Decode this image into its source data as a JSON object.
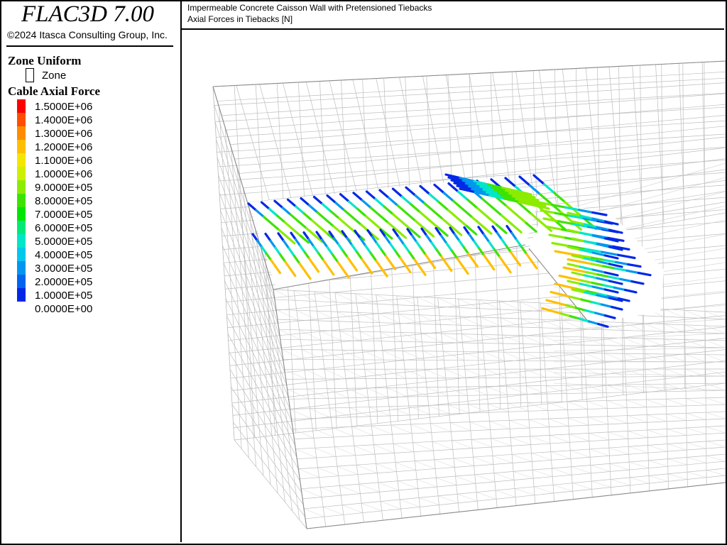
{
  "app": {
    "title": "FLAC3D 7.00",
    "copyright": "©2024 Itasca Consulting Group, Inc."
  },
  "header": {
    "line1": "Impermeable Concrete Caisson Wall with Pretensioned Tiebacks",
    "line2": "Axial Forces in Tiebacks [N]"
  },
  "legend": {
    "zone_section": "Zone Uniform",
    "zone_item": "Zone",
    "cable_section": "Cable Axial Force",
    "ticks": [
      "1.5000E+06",
      "1.4000E+06",
      "1.3000E+06",
      "1.2000E+06",
      "1.1000E+06",
      "1.0000E+06",
      "9.0000E+05",
      "8.0000E+05",
      "7.0000E+05",
      "6.0000E+05",
      "5.0000E+05",
      "4.0000E+05",
      "3.0000E+05",
      "2.0000E+05",
      "1.0000E+05",
      "0.0000E+00"
    ],
    "colors": [
      "#ff0000",
      "#ff4e00",
      "#ff8c00",
      "#ffbf00",
      "#f5e600",
      "#cdf000",
      "#8cec00",
      "#3de300",
      "#00e600",
      "#00ea78",
      "#00e6c8",
      "#00c8ee",
      "#0096f0",
      "#0064f0",
      "#0028e6"
    ]
  },
  "model": {
    "mesh_color": "#bdbdbd",
    "cable_colors": {
      "low": "#0028e6",
      "mid_low": "#0096f0",
      "mid": "#00e6c8",
      "mid_high": "#3de300",
      "high": "#8cec00",
      "yellow": "#ffbf00"
    }
  }
}
